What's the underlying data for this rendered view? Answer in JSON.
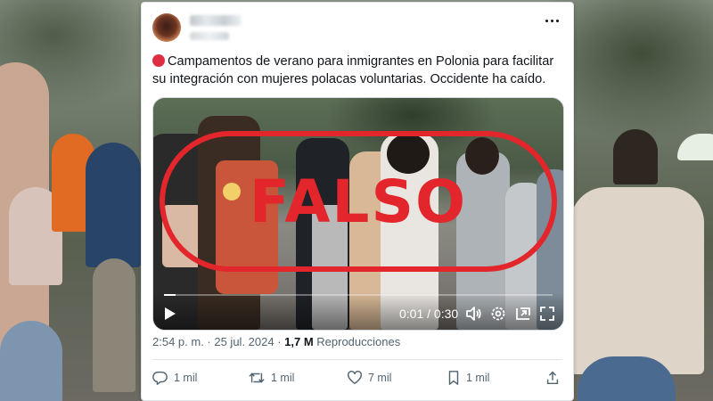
{
  "post": {
    "text": "Campamentos de verano para inmigrantes en Polonia para facilitar su integración con mujeres polacas voluntarias. Occidente ha caído.",
    "emoji": "red-circle"
  },
  "video": {
    "stamp": "FALSO",
    "time": "0:01 / 0:30",
    "progress": 0.03
  },
  "meta": {
    "datetime": "2:54 p. m. · 25 jul. 2024 · ",
    "views_count": "1,7 M",
    "views_label": " Reproducciones"
  },
  "actions": {
    "replies": "1 mil",
    "reposts": "1 mil",
    "likes": "7 mil",
    "bookmarks": "1 mil"
  },
  "colors": {
    "stamp_red": "#e2262c",
    "text": "#0f1419",
    "muted": "#536471"
  },
  "icons": [
    "more-icon",
    "play-icon",
    "volume-icon",
    "settings-icon",
    "pip-icon",
    "fullscreen-icon",
    "reply-icon",
    "repost-icon",
    "like-icon",
    "bookmark-icon",
    "share-icon"
  ]
}
